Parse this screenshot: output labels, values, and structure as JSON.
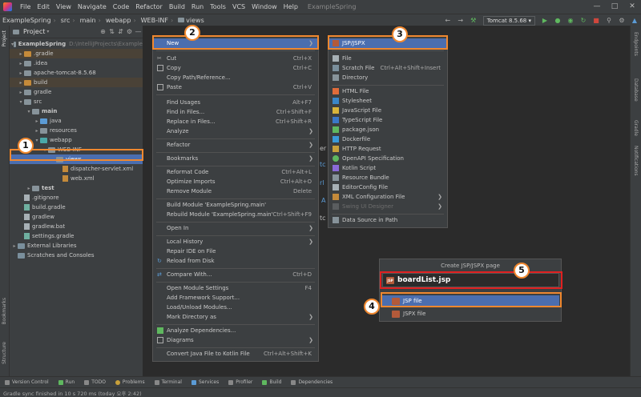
{
  "titlebar": {
    "menus": [
      "File",
      "Edit",
      "View",
      "Navigate",
      "Code",
      "Refactor",
      "Build",
      "Run",
      "Tools",
      "VCS",
      "Window",
      "Help"
    ],
    "app_name": "ExampleSpring"
  },
  "breadcrumb": [
    "ExampleSpring",
    "src",
    "main",
    "webapp",
    "WEB-INF",
    "views"
  ],
  "toolbar": {
    "run_config": "Tomcat 8.5.68"
  },
  "left_stripe": {
    "project": "Project",
    "bookmarks": "Bookmarks",
    "structure": "Structure"
  },
  "right_stripe": {
    "endpoints": "Endpoints",
    "database": "Database",
    "gradle": "Gradle",
    "notifications": "Notifications"
  },
  "project_panel": {
    "title": "Project",
    "tree": [
      {
        "label": "ExampleSpring",
        "extra": "D:\\IntelliJProjects\\Example",
        "bold": true
      },
      {
        "label": ".gradle"
      },
      {
        "label": ".idea"
      },
      {
        "label": "apache-tomcat-8.5.68"
      },
      {
        "label": "build"
      },
      {
        "label": "gradle"
      },
      {
        "label": "src"
      },
      {
        "label": "main",
        "bold": true
      },
      {
        "label": "java"
      },
      {
        "label": "resources"
      },
      {
        "label": "webapp"
      },
      {
        "label": "WEB-INF"
      },
      {
        "label": "views"
      },
      {
        "label": "dispatcher-servlet.xml"
      },
      {
        "label": "web.xml"
      },
      {
        "label": "test",
        "bold": true
      },
      {
        "label": ".gitignore"
      },
      {
        "label": "build.gradle"
      },
      {
        "label": "gradlew"
      },
      {
        "label": "gradlew.bat"
      },
      {
        "label": "settings.gradle"
      },
      {
        "label": "External Libraries"
      },
      {
        "label": "Scratches and Consoles"
      }
    ]
  },
  "context_menu": {
    "items": [
      {
        "label": "New",
        "shortcut": ""
      },
      {
        "label": "Cut",
        "shortcut": "Ctrl+X"
      },
      {
        "label": "Copy",
        "shortcut": "Ctrl+C"
      },
      {
        "label": "Copy Path/Reference...",
        "shortcut": ""
      },
      {
        "label": "Paste",
        "shortcut": "Ctrl+V"
      },
      {
        "label": "Find Usages",
        "shortcut": "Alt+F7"
      },
      {
        "label": "Find in Files...",
        "shortcut": "Ctrl+Shift+F"
      },
      {
        "label": "Replace in Files...",
        "shortcut": "Ctrl+Shift+R"
      },
      {
        "label": "Analyze",
        "shortcut": ""
      },
      {
        "label": "Refactor",
        "shortcut": ""
      },
      {
        "label": "Bookmarks",
        "shortcut": ""
      },
      {
        "label": "Reformat Code",
        "shortcut": "Ctrl+Alt+L"
      },
      {
        "label": "Optimize Imports",
        "shortcut": "Ctrl+Alt+O"
      },
      {
        "label": "Remove Module",
        "shortcut": "Delete"
      },
      {
        "label": "Build Module 'ExampleSpring.main'",
        "shortcut": ""
      },
      {
        "label": "Rebuild Module 'ExampleSpring.main'",
        "shortcut": "Ctrl+Shift+F9"
      },
      {
        "label": "Open In",
        "shortcut": ""
      },
      {
        "label": "Local History",
        "shortcut": ""
      },
      {
        "label": "Repair IDE on File",
        "shortcut": ""
      },
      {
        "label": "Reload from Disk",
        "shortcut": ""
      },
      {
        "label": "Compare With...",
        "shortcut": "Ctrl+D"
      },
      {
        "label": "Open Module Settings",
        "shortcut": "F4"
      },
      {
        "label": "Add Framework Support...",
        "shortcut": ""
      },
      {
        "label": "Load/Unload Modules...",
        "shortcut": ""
      },
      {
        "label": "Mark Directory as",
        "shortcut": ""
      },
      {
        "label": "Analyze Dependencies...",
        "shortcut": ""
      },
      {
        "label": "Diagrams",
        "shortcut": ""
      },
      {
        "label": "Convert Java File to Kotlin File",
        "shortcut": "Ctrl+Alt+Shift+K"
      }
    ]
  },
  "new_submenu": {
    "items": [
      {
        "label": "JSP/JSPX",
        "shortcut": ""
      },
      {
        "label": "File",
        "shortcut": ""
      },
      {
        "label": "Scratch File",
        "shortcut": "Ctrl+Alt+Shift+Insert"
      },
      {
        "label": "Directory",
        "shortcut": ""
      },
      {
        "label": "HTML File",
        "shortcut": ""
      },
      {
        "label": "Stylesheet",
        "shortcut": ""
      },
      {
        "label": "JavaScript File",
        "shortcut": ""
      },
      {
        "label": "TypeScript File",
        "shortcut": ""
      },
      {
        "label": "package.json",
        "shortcut": ""
      },
      {
        "label": "Dockerfile",
        "shortcut": ""
      },
      {
        "label": "HTTP Request",
        "shortcut": ""
      },
      {
        "label": "OpenAPI Specification",
        "shortcut": ""
      },
      {
        "label": "Kotlin Script",
        "shortcut": ""
      },
      {
        "label": "Resource Bundle",
        "shortcut": ""
      },
      {
        "label": "EditorConfig File",
        "shortcut": ""
      },
      {
        "label": "XML Configuration File",
        "shortcut": ""
      },
      {
        "label": "Swing UI Designer",
        "shortcut": ""
      },
      {
        "label": "Data Source in Path",
        "shortcut": ""
      }
    ]
  },
  "dialog": {
    "title": "Create JSP/JSPX page",
    "input_value": "boardList.jsp",
    "options": [
      "JSP file",
      "JSPX file"
    ],
    "file_icon": "JSP"
  },
  "editor_fragments": [
    "er",
    "tc",
    "rl",
    "A",
    "tc"
  ],
  "callouts": [
    "1",
    "2",
    "3",
    "4",
    "5"
  ],
  "bottom_tabs": [
    "Version Control",
    "Run",
    "TODO",
    "Problems",
    "Terminal",
    "Services",
    "Profiler",
    "Build",
    "Dependencies"
  ],
  "status": "Gradle sync finished in 10 s 720 ms (today 오후 2:42)",
  "colors": {
    "selection": "#4b6eaf",
    "highlight": "#f0882f",
    "input_highlight": "#e02020"
  }
}
